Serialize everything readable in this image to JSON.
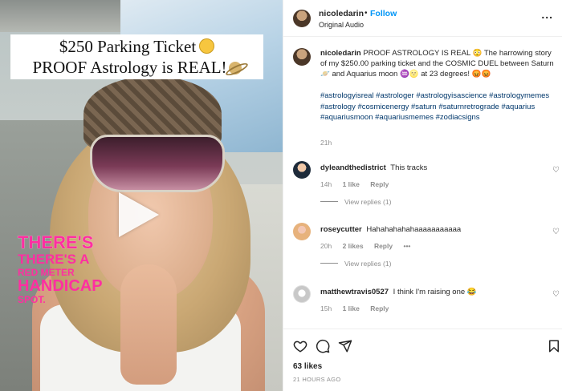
{
  "video": {
    "title_line1": "$250 Parking Ticket",
    "title_line2": "PROOF Astrology is REAL!",
    "overlay_line1": "THERE'S",
    "overlay_line2": "THERE'S A",
    "overlay_line3": "RED METER",
    "overlay_line4": "HANDICAP",
    "overlay_line5": "SPOT.",
    "overlay_color": "#ff2fa1"
  },
  "header": {
    "username": "nicoledarin",
    "separator": "•",
    "follow_label": "Follow",
    "audio_label": "Original Audio",
    "more_label": "..."
  },
  "post": {
    "username": "nicoledarin",
    "caption": "PROOF ASTROLOGY IS REAL 😳 The harrowing story of my $250.00 parking ticket and the COSMIC DUEL between Saturn 🪐 and Aquarius moon ♒🌝 at 23 degrees! 😡😡",
    "hashtags": "#astrologyisreal #astrologer #astrologyisascience #astrologymemes #astrology #cosmicenergy #saturn #saturnretrograde #aquarius #aquariusmoon #aquariusmemes #zodiacsigns",
    "time": "21h"
  },
  "comments": [
    {
      "username": "dyleandthedistrict",
      "text": "This tracks",
      "time": "14h",
      "likes": "1 like",
      "reply": "Reply",
      "view_replies": "View replies (1)"
    },
    {
      "username": "roseycutter",
      "text": "Hahahahahahaaaaaaaaaaa",
      "time": "20h",
      "likes": "2 likes",
      "reply": "Reply",
      "more": "•••",
      "view_replies": "View replies (1)"
    },
    {
      "username": "matthewtravis0527",
      "text": "I think I'm raising one 😂",
      "time": "15h",
      "likes": "1 like",
      "reply": "Reply"
    }
  ],
  "actions": {
    "likes": "63 likes",
    "posted_ago": "21 HOURS AGO"
  },
  "colors": {
    "link_blue": "#0095f6",
    "hashtag_blue": "#00376b",
    "muted_gray": "#8e8e8e"
  }
}
